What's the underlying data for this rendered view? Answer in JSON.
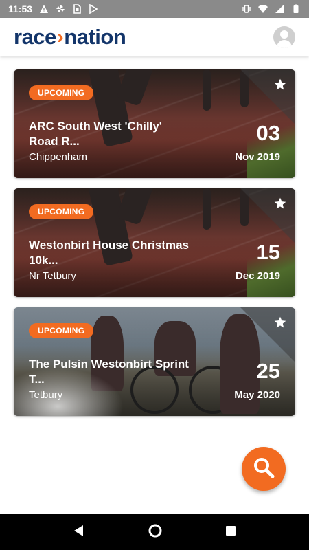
{
  "status_bar": {
    "time": "11:53",
    "left_icons": [
      "warning-icon",
      "pinwheel-icon",
      "sim-icon",
      "play-store-icon"
    ],
    "right_icons": [
      "vibrate-icon",
      "wifi-icon",
      "signal-icon",
      "battery-icon"
    ]
  },
  "app_bar": {
    "logo_left": "race",
    "logo_chevron": "›",
    "logo_right": "nation",
    "brand_navy": "#13356a",
    "brand_orange": "#f26b21"
  },
  "events": [
    {
      "status": "UPCOMING",
      "title": "ARC South West 'Chilly' Road R...",
      "location": "Chippenham",
      "day": "03",
      "month_year": "Nov 2019",
      "background": "track-runners"
    },
    {
      "status": "UPCOMING",
      "title": "Westonbirt House Christmas 10k...",
      "location": "Nr Tetbury",
      "day": "15",
      "month_year": "Dec 2019",
      "background": "track-runners"
    },
    {
      "status": "UPCOMING",
      "title": "The Pulsin Westonbirt Sprint T...",
      "location": "Tetbury",
      "day": "25",
      "month_year": "May 2020",
      "background": "triathletes"
    }
  ],
  "fab": {
    "icon": "search-icon"
  },
  "nav_bar": {
    "buttons": [
      "back-icon",
      "home-icon",
      "recents-icon"
    ]
  }
}
